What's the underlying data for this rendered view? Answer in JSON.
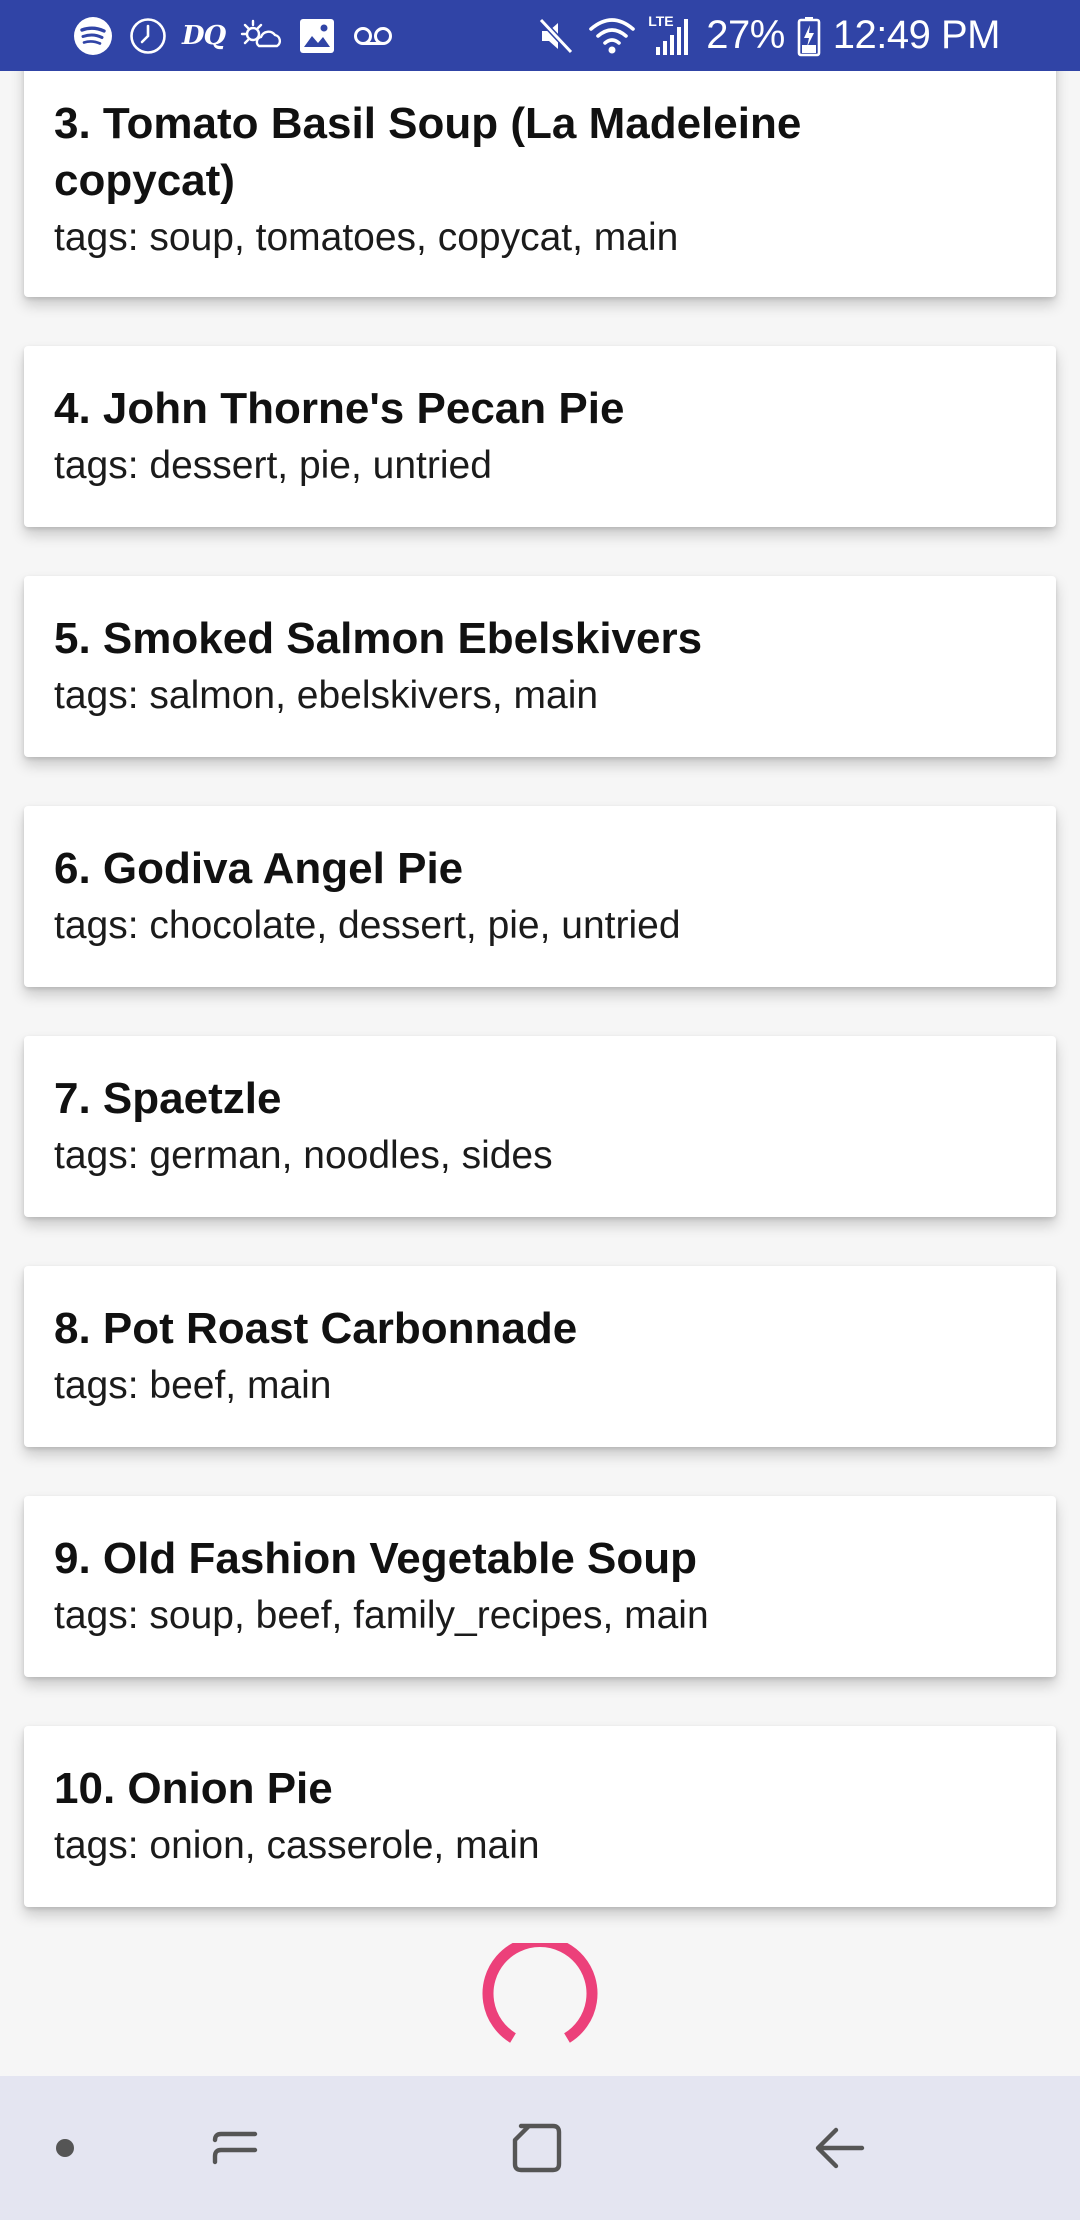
{
  "status_bar": {
    "background": "#3044a6",
    "left_icons": [
      "spotify-icon",
      "clock-icon",
      "dq-icon",
      "weather-icon",
      "image-icon",
      "voicemail-icon"
    ],
    "dq_text": "DQ",
    "right_icons": [
      "mute-icon",
      "wifi-icon",
      "signal-icon",
      "battery-icon"
    ],
    "network_label": "LTE",
    "battery_percent": "27%",
    "time": "12:49 PM"
  },
  "recipes": [
    {
      "title": "3. Tomato Basil Soup (La Madeleine copycat)",
      "tags": "tags: soup, tomatoes, copycat, main"
    },
    {
      "title": "4. John Thorne's Pecan Pie",
      "tags": "tags: dessert, pie, untried"
    },
    {
      "title": "5. Smoked Salmon Ebelskivers",
      "tags": "tags: salmon, ebelskivers, main"
    },
    {
      "title": "6. Godiva Angel Pie",
      "tags": "tags: chocolate, dessert, pie, untried"
    },
    {
      "title": "7. Spaetzle",
      "tags": "tags: german, noodles, sides"
    },
    {
      "title": "8. Pot Roast Carbonnade",
      "tags": "tags: beef, main"
    },
    {
      "title": "9. Old Fashion Vegetable Soup",
      "tags": "tags: soup, beef, family_recipes, main"
    },
    {
      "title": "10. Onion Pie",
      "tags": "tags: onion, casserole, main"
    }
  ],
  "spinner": {
    "color": "#ec407a",
    "icon": "loading-spinner-icon"
  },
  "nav_bar": {
    "background": "#e4e5f1",
    "buttons": [
      "dot-icon",
      "recent-apps-icon",
      "home-icon",
      "back-icon"
    ]
  }
}
